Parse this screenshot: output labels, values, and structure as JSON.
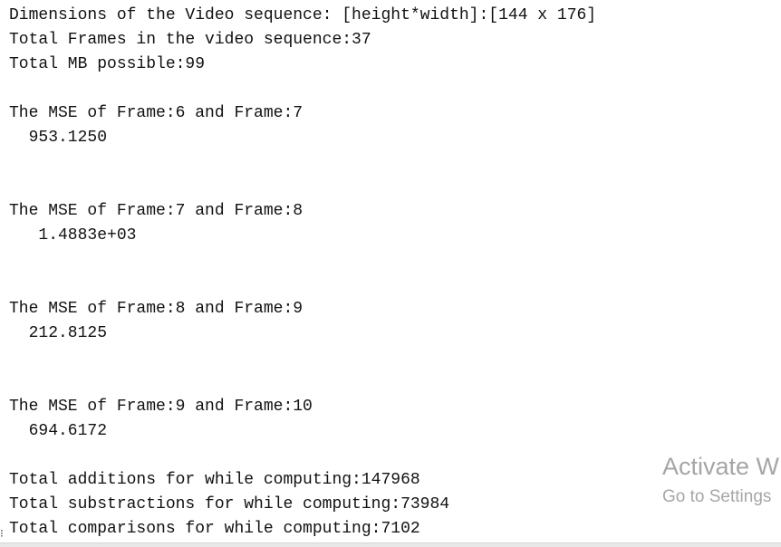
{
  "console": {
    "lines": [
      "Dimensions of the Video sequence: [height*width]:[144 x 176]",
      "Total Frames in the video sequence:37",
      "Total MB possible:99"
    ],
    "mse_blocks": [
      {
        "heading": "The MSE of Frame:6 and Frame:7",
        "value": "  953.1250"
      },
      {
        "heading": "The MSE of Frame:7 and Frame:8",
        "value": "   1.4883e+03"
      },
      {
        "heading": "The MSE of Frame:8 and Frame:9",
        "value": "  212.8125"
      },
      {
        "heading": "The MSE of Frame:9 and Frame:10",
        "value": "  694.6172"
      }
    ],
    "totals": [
      "Total additions for while computing:147968",
      "Total substractions for while computing:73984",
      "Total comparisons for while computing:7102"
    ]
  },
  "watermark": {
    "title": "Activate W",
    "subtitle": "Go to Settings"
  },
  "colors": {
    "text": "#111111",
    "watermark": "#a6a6a6",
    "background": "#ffffff"
  }
}
